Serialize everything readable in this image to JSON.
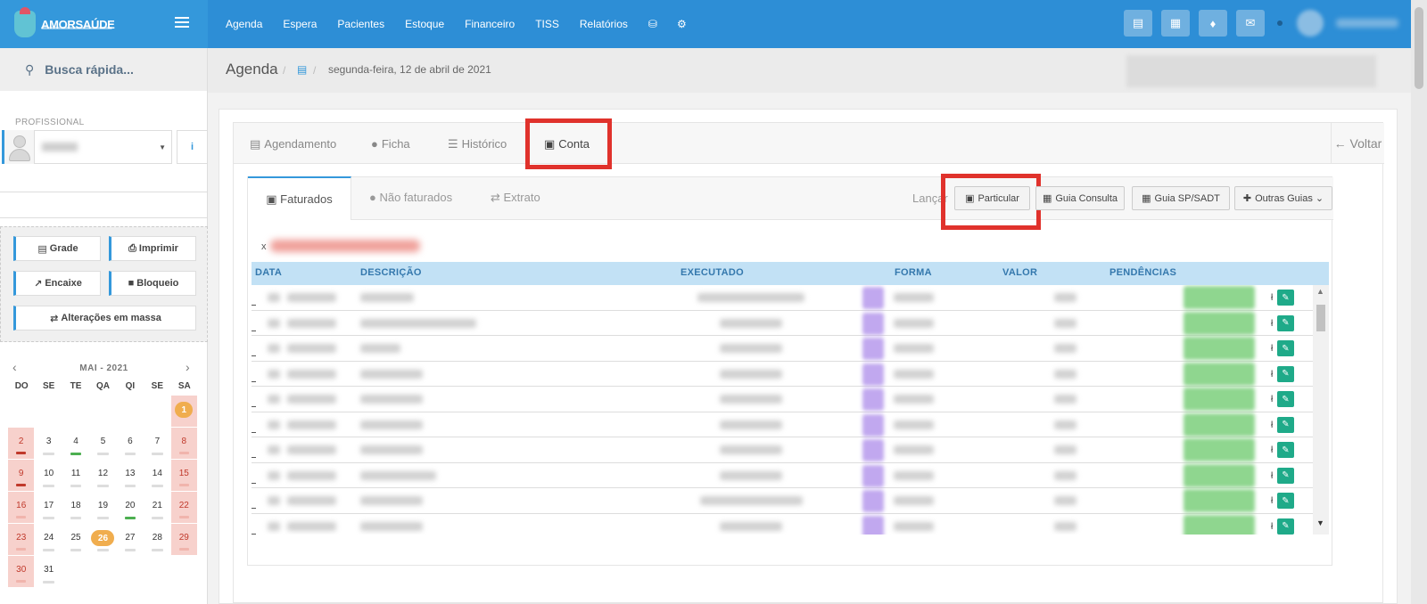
{
  "brand": {
    "name": "AMORSAÚDE"
  },
  "nav": {
    "items": [
      "Agenda",
      "Espera",
      "Pacientes",
      "Estoque",
      "Financeiro",
      "TISS",
      "Relatórios"
    ],
    "icons": [
      "database-icon",
      "gear-icon"
    ],
    "right_icons": [
      "inbox-icon",
      "card-icon",
      "bell-icon",
      "chat-icon"
    ]
  },
  "sidebar": {
    "search_label": "Busca rápida...",
    "profissional_label": "PROFISSIONAL",
    "info_label": "i",
    "buttons": {
      "grade": "Grade",
      "imprimir": "Imprimir",
      "encaixe": "Encaixe",
      "bloqueio": "Bloqueio",
      "alteracoes": "Alterações em massa"
    }
  },
  "calendar": {
    "month": "MAI - 2021",
    "dow": [
      "DO",
      "SE",
      "TE",
      "QA",
      "QI",
      "SE",
      "SA"
    ],
    "badge_days": [
      "1",
      "26"
    ]
  },
  "breadcrumb": {
    "title": "Agenda",
    "date": "segunda-feira, 12 de abril de 2021"
  },
  "tabs": {
    "agendamento": "Agendamento",
    "ficha": "Ficha",
    "historico": "Histórico",
    "conta": "Conta",
    "voltar": "Voltar"
  },
  "subtabs": {
    "faturados": "Faturados",
    "nao_faturados": "Não faturados",
    "extrato": "Extrato"
  },
  "actions": {
    "lancar": "Lançar",
    "particular": "Particular",
    "guia_consulta": "Guia Consulta",
    "guia_sp": "Guia SP/SADT",
    "outras_guias": "Outras Guias"
  },
  "filter": {
    "prefix": "x"
  },
  "table": {
    "columns": [
      "DATA",
      "DESCRIÇÃO",
      "EXECUTADO",
      "FORMA",
      "VALOR",
      "PENDÊNCIAS"
    ]
  },
  "colors": {
    "navbar": "#2d8ed6",
    "brand_bg": "#3498db",
    "highlight": "#e0322c",
    "table_header": "#c2e1f5",
    "row_action": "#1faa89"
  }
}
